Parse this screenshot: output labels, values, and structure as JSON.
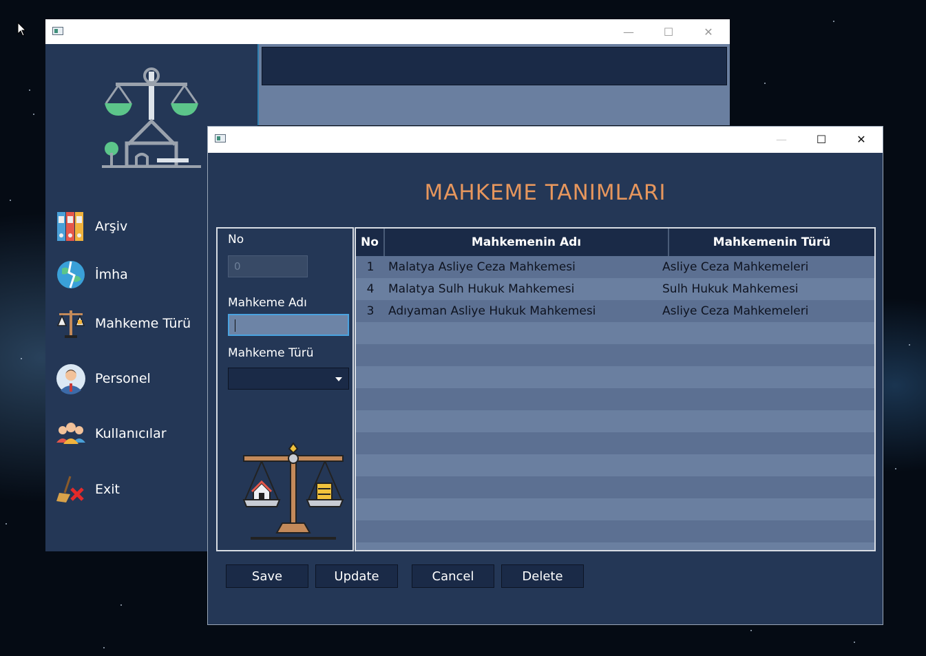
{
  "back_window": {
    "nav": [
      {
        "label": "Arşiv",
        "icon": "binders-icon"
      },
      {
        "label": "İmha",
        "icon": "shredded-globe-icon"
      },
      {
        "label": "Mahkeme Türü",
        "icon": "scales-icon"
      },
      {
        "label": "Personel",
        "icon": "person-avatar-icon"
      },
      {
        "label": "Kullanıcılar",
        "icon": "users-group-icon"
      },
      {
        "label": "Exit",
        "icon": "broom-exit-icon"
      }
    ]
  },
  "dialog": {
    "heading": "MAHKEME TANIMLARI",
    "form": {
      "no_label": "No",
      "no_value": "0",
      "name_label": "Mahkeme Adı",
      "name_value": "",
      "type_label": "Mahkeme Türü",
      "type_value": ""
    },
    "table": {
      "headers": [
        "No",
        "Mahkemenin Adı",
        "Mahkemenin Türü"
      ],
      "rows": [
        {
          "no": "1",
          "name": "Malatya Asliye Ceza Mahkemesi",
          "type": "Asliye Ceza Mahkemeleri"
        },
        {
          "no": "4",
          "name": "Malatya Sulh Hukuk Mahkemesi",
          "type": "Sulh Hukuk Mahkemesi"
        },
        {
          "no": "3",
          "name": "Adıyaman Asliye Hukuk Mahkemesi",
          "type": "Asliye Ceza Mahkemeleri"
        }
      ]
    },
    "buttons": {
      "save": "Save",
      "update": "Update",
      "cancel": "Cancel",
      "delete": "Delete"
    }
  },
  "colors": {
    "heading": "#e6965d",
    "panel": "#243756",
    "header_bg": "#1a2a47"
  }
}
